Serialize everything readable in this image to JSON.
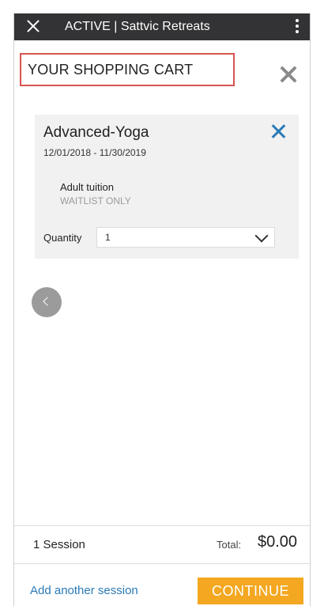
{
  "appbar": {
    "title": "ACTIVE | Sattvic Retreats",
    "close_icon": "close-icon",
    "menu_icon": "more-vertical-icon",
    "background_color": "#333335"
  },
  "cart": {
    "title": "YOUR SHOPPING CART",
    "close_icon": "close-icon",
    "highlight_color": "#d9534f"
  },
  "session": {
    "name": "Advanced-Yoga",
    "dates": "12/01/2018 - 11/30/2019",
    "fee_name": "Adult tuition",
    "fee_status": "WAITLIST ONLY",
    "quantity_label": "Quantity",
    "quantity_value": "1",
    "remove_icon": "close-icon",
    "accent_color": "#2a7ab8"
  },
  "carousel": {
    "prev_icon": "chevron-left-icon"
  },
  "summary": {
    "session_count": "1 Session",
    "total_label": "Total:",
    "total_value": "$0.00"
  },
  "actions": {
    "add_session": "Add another session",
    "continue": "CONTINUE",
    "continue_color": "#f4a720"
  }
}
